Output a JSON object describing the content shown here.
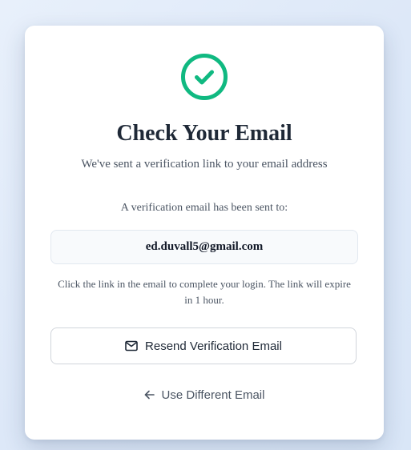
{
  "card": {
    "icon": "check-circle-icon",
    "title": "Check Your Email",
    "subtitle": "We've sent a verification link to your email address",
    "sent_to_label": "A verification email has been sent to:",
    "email": "ed.duvall5@gmail.com",
    "note": "Click the link in the email to complete your login. The link will expire in 1 hour.",
    "resend_button": {
      "icon": "mail-icon",
      "label": "Resend Verification Email"
    },
    "different_email_link": {
      "icon": "arrow-left-icon",
      "label": "Use Different Email"
    }
  },
  "colors": {
    "accent": "#10b981",
    "title": "#1f2937",
    "muted_text": "#4b5563",
    "background": "#e3edfa"
  }
}
